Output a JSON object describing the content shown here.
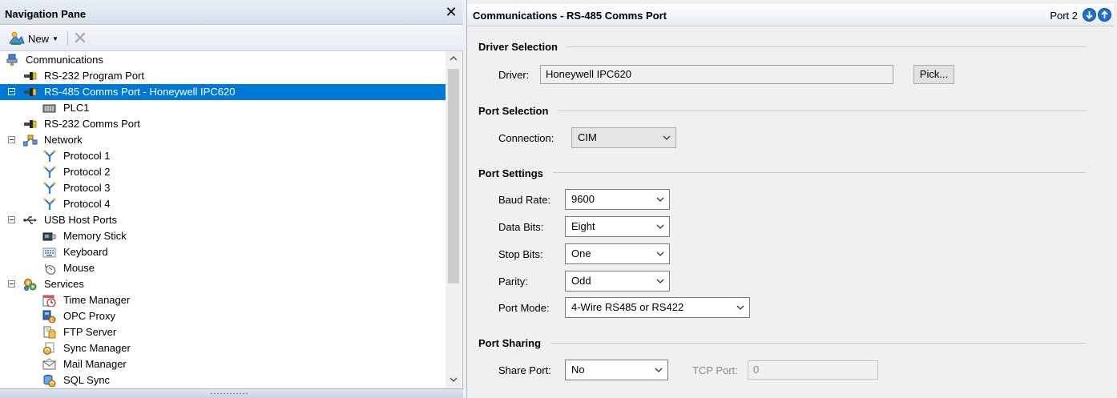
{
  "nav": {
    "title": "Navigation Pane",
    "close_glyph": "✕",
    "toolbar": {
      "new_label": "New",
      "delete_glyph": "✕"
    },
    "tree": [
      {
        "label": "Communications",
        "icon": "comms-icon"
      },
      {
        "label": "RS-232 Program Port",
        "icon": "serial-port-icon"
      },
      {
        "label": "RS-485 Comms Port - Honeywell IPC620",
        "icon": "serial-port-icon",
        "selected": true
      },
      {
        "label": "PLC1",
        "icon": "device-icon"
      },
      {
        "label": "RS-232 Comms Port",
        "icon": "serial-port-icon"
      },
      {
        "label": "Network",
        "icon": "network-icon"
      },
      {
        "label": "Protocol 1",
        "icon": "protocol-icon"
      },
      {
        "label": "Protocol 2",
        "icon": "protocol-icon"
      },
      {
        "label": "Protocol 3",
        "icon": "protocol-icon"
      },
      {
        "label": "Protocol 4",
        "icon": "protocol-icon"
      },
      {
        "label": "USB Host Ports",
        "icon": "usb-icon"
      },
      {
        "label": "Memory Stick",
        "icon": "memory-stick-icon"
      },
      {
        "label": "Keyboard",
        "icon": "keyboard-icon"
      },
      {
        "label": "Mouse",
        "icon": "mouse-icon"
      },
      {
        "label": "Services",
        "icon": "services-icon"
      },
      {
        "label": "Time Manager",
        "icon": "time-manager-icon"
      },
      {
        "label": "OPC Proxy",
        "icon": "opc-proxy-icon"
      },
      {
        "label": "FTP Server",
        "icon": "ftp-server-icon"
      },
      {
        "label": "Sync Manager",
        "icon": "sync-manager-icon"
      },
      {
        "label": "Mail Manager",
        "icon": "mail-manager-icon"
      },
      {
        "label": "SQL Sync",
        "icon": "sql-sync-icon"
      }
    ]
  },
  "main": {
    "title": "Communications - RS-485 Comms Port",
    "port_label": "Port 2",
    "sections": {
      "driver": "Driver Selection",
      "port_selection": "Port Selection",
      "port_settings": "Port Settings",
      "port_sharing": "Port Sharing"
    },
    "driver": {
      "label": "Driver:",
      "value": "Honeywell IPC620",
      "pick_label": "Pick..."
    },
    "connection": {
      "label": "Connection:",
      "value": "CIM"
    },
    "baud_rate": {
      "label": "Baud Rate:",
      "value": "9600"
    },
    "data_bits": {
      "label": "Data Bits:",
      "value": "Eight"
    },
    "stop_bits": {
      "label": "Stop Bits:",
      "value": "One"
    },
    "parity": {
      "label": "Parity:",
      "value": "Odd"
    },
    "port_mode": {
      "label": "Port Mode:",
      "value": "4-Wire RS485 or RS422"
    },
    "share_port": {
      "label": "Share Port:",
      "value": "No"
    },
    "tcp_port": {
      "label": "TCP Port:",
      "value": "0"
    }
  },
  "colors": {
    "selection": "#0078d7",
    "accent_button": "#1f6fd1"
  }
}
